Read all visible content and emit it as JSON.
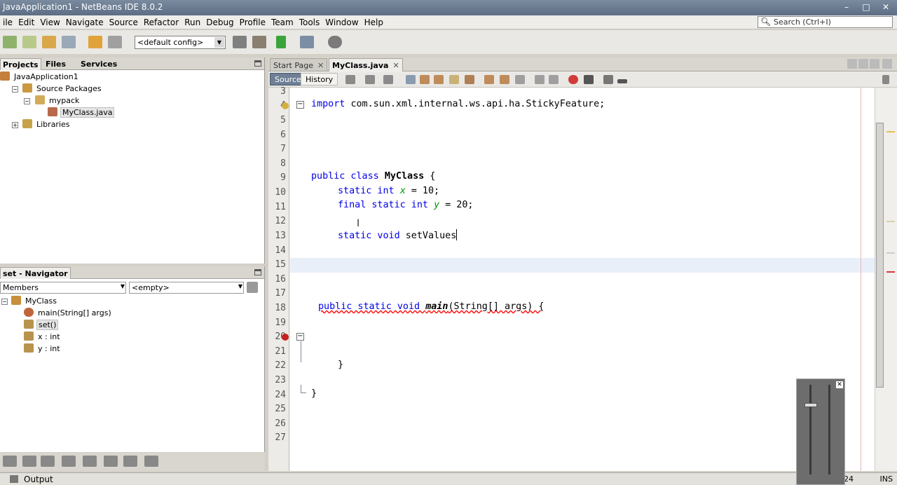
{
  "window": {
    "title": "JavaApplication1 - NetBeans IDE 8.0.2",
    "controls": [
      "–",
      "□",
      "✕"
    ]
  },
  "menu": [
    "ile",
    "Edit",
    "View",
    "Navigate",
    "Source",
    "Refactor",
    "Run",
    "Debug",
    "Profile",
    "Team",
    "Tools",
    "Window",
    "Help"
  ],
  "search": {
    "placeholder": "Search (Ctrl+I)"
  },
  "toolbar": {
    "config": "<default config>"
  },
  "projects_panel": {
    "tabs": [
      "Projects",
      "Files",
      "Services"
    ],
    "tree": [
      {
        "label": "JavaApplication1",
        "level": 0
      },
      {
        "label": "Source Packages",
        "level": 1
      },
      {
        "label": "mypack",
        "level": 2
      },
      {
        "label": "MyClass.java",
        "level": 3
      },
      {
        "label": "Libraries",
        "level": 1
      }
    ]
  },
  "navigator": {
    "title": "set - Navigator",
    "filter": "Members",
    "scope": "<empty>",
    "tree": [
      {
        "label": "MyClass",
        "level": 0
      },
      {
        "label": "main(String[] args)",
        "level": 1
      },
      {
        "label": "set()",
        "level": 1
      },
      {
        "label": "x : int",
        "level": 1
      },
      {
        "label": "y : int",
        "level": 1
      }
    ]
  },
  "editor": {
    "tabs": [
      "Start Page",
      "MyClass.java"
    ],
    "source_label": "Source",
    "history_label": "History",
    "line_numbers": [
      "3",
      "4",
      "5",
      "6",
      "7",
      "8",
      "9",
      "10",
      "11",
      "12",
      "13",
      "14",
      "15",
      "16",
      "17",
      "18",
      "19",
      "20",
      "21",
      "22",
      "23",
      "24",
      "25",
      "26",
      "27"
    ],
    "code": {
      "l4": [
        "import ",
        "com.sun.xml.internal.ws.api.ha.StickyFeature;"
      ],
      "l9": [
        "public class ",
        "MyClass",
        " {"
      ],
      "l10": [
        "static int ",
        "x",
        " = 10;"
      ],
      "l11": [
        "final static int ",
        "y",
        " = 20;"
      ],
      "l13": [
        "static void ",
        "setValues"
      ],
      "l18": [
        "public static void ",
        "main",
        "(String[] args) {"
      ],
      "l22": "}",
      "l24": "}"
    }
  },
  "status": {
    "output": "Output",
    "position": "24",
    "mode": "INS"
  },
  "volume_overlay": {
    "close": "✕"
  }
}
